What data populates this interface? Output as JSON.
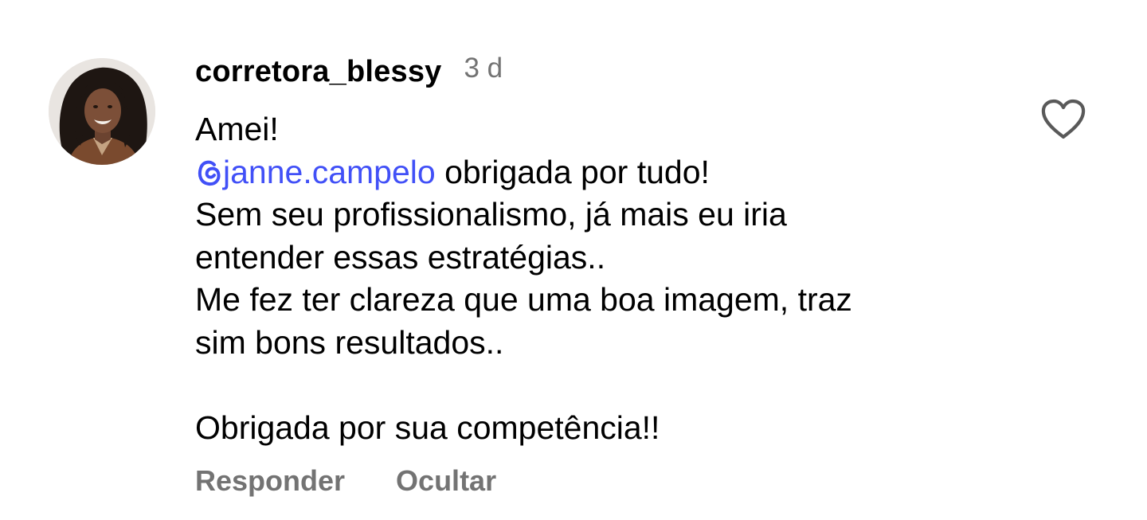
{
  "comment": {
    "author": "corretora_blessy",
    "time": "3 d",
    "avatar_icon": "profile-photo",
    "body": {
      "line1": "Amei!",
      "mention": "janne.campelo",
      "mention_icon": "threads-icon",
      "line2_rest": " obrigada por tudo!",
      "line3": "Sem seu profissionalismo, já mais eu iria",
      "line4": "entender essas estratégias..",
      "line5": "Me fez ter clareza que uma boa imagem, traz",
      "line6": "sim bons resultados..",
      "line7": "Obrigada por sua competência!!"
    },
    "actions": {
      "reply": "Responder",
      "hide": "Ocultar"
    },
    "like_icon": "heart-outline-icon"
  },
  "colors": {
    "mention": "#4150f7",
    "muted": "#737373",
    "text": "#000000"
  }
}
